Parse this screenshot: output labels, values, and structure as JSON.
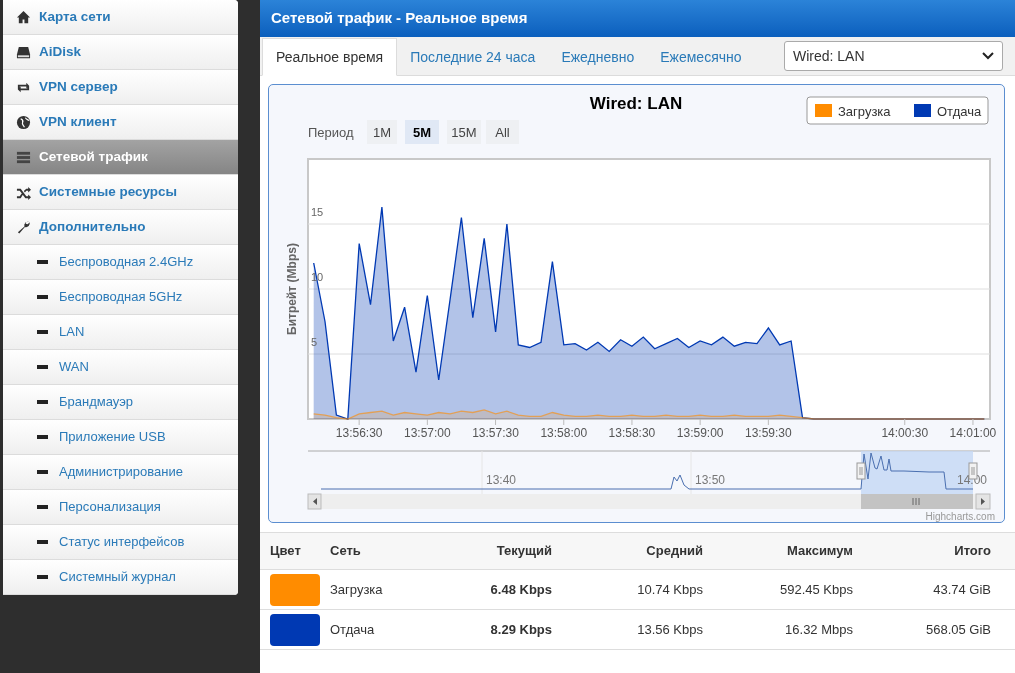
{
  "sidebar": {
    "items": [
      {
        "label": "Карта сети",
        "kind": "section",
        "selected": false
      },
      {
        "label": "AiDisk",
        "kind": "section",
        "selected": false
      },
      {
        "label": "VPN сервер",
        "kind": "section",
        "selected": false
      },
      {
        "label": "VPN клиент",
        "kind": "section",
        "selected": false
      },
      {
        "label": "Сетевой трафик",
        "kind": "section",
        "selected": true
      },
      {
        "label": "Системные ресурсы",
        "kind": "section",
        "selected": false
      },
      {
        "label": "Дополнительно",
        "kind": "section",
        "selected": false
      },
      {
        "label": "Беспроводная 2.4GHz",
        "kind": "sub",
        "selected": false
      },
      {
        "label": "Беспроводная 5GHz",
        "kind": "sub",
        "selected": false
      },
      {
        "label": "LAN",
        "kind": "sub",
        "selected": false
      },
      {
        "label": "WAN",
        "kind": "sub",
        "selected": false
      },
      {
        "label": "Брандмауэр",
        "kind": "sub",
        "selected": false
      },
      {
        "label": "Приложение USB",
        "kind": "sub",
        "selected": false
      },
      {
        "label": "Администрирование",
        "kind": "sub",
        "selected": false
      },
      {
        "label": "Персонализация",
        "kind": "sub",
        "selected": false
      },
      {
        "label": "Статус интерфейсов",
        "kind": "sub",
        "selected": false
      },
      {
        "label": "Системный журнал",
        "kind": "sub",
        "selected": false
      }
    ]
  },
  "panel": {
    "title": "Сетевой трафик - Реальное время",
    "tabs": [
      {
        "label": "Реальное время",
        "selected": true
      },
      {
        "label": "Последние 24 часа",
        "selected": false
      },
      {
        "label": "Ежедневно",
        "selected": false
      },
      {
        "label": "Ежемесячно",
        "selected": false
      }
    ],
    "interface_select": {
      "value": "Wired: LAN"
    },
    "chart": {
      "period_label": "Период",
      "range_buttons": [
        {
          "label": "1M",
          "selected": false
        },
        {
          "label": "5M",
          "selected": true
        },
        {
          "label": "15M",
          "selected": false
        },
        {
          "label": "All",
          "selected": false
        }
      ],
      "navigator_labels": [
        "13:40",
        "13:50",
        "14:00"
      ],
      "credit": "Highcharts.com",
      "chart_data": {
        "type": "area",
        "title": "Wired: LAN",
        "ylabel": "Битрейт (Mbps)",
        "categories": [
          null,
          null,
          null,
          null,
          "13:56:30",
          null,
          null,
          null,
          null,
          null,
          "13:57:00",
          null,
          null,
          null,
          null,
          null,
          "13:57:30",
          null,
          null,
          null,
          null,
          null,
          "13:58:00",
          null,
          null,
          null,
          null,
          null,
          "13:58:30",
          null,
          null,
          null,
          null,
          null,
          "13:59:00",
          null,
          null,
          null,
          null,
          null,
          "13:59:30",
          null,
          null,
          null,
          null,
          null,
          null,
          null,
          null,
          null,
          null,
          null,
          "14:00:30",
          null,
          null,
          null,
          null,
          null,
          "14:01:00",
          null
        ],
        "series": [
          {
            "name": "Загрузка",
            "color": "#ff8c00",
            "values": [
              0.4,
              0.3,
              0.1,
              0,
              0.4,
              0.5,
              0.6,
              0.3,
              0.5,
              0.4,
              0.3,
              0.5,
              0.4,
              0.6,
              0.5,
              0.7,
              0.4,
              0.6,
              0.3,
              0.2,
              0.2,
              0.5,
              0.3,
              0.2,
              0.2,
              0.3,
              0.2,
              0.2,
              0.3,
              0.2,
              0.2,
              0.3,
              0.2,
              0.2,
              0.3,
              0.2,
              0.2,
              0.3,
              0.2,
              0.2,
              0.2,
              0.3,
              0.2,
              0.1,
              0,
              0,
              0,
              0,
              0,
              0,
              0,
              0,
              0,
              0,
              0,
              0,
              0,
              0,
              0,
              0
            ]
          },
          {
            "name": "Отдача",
            "color": "#0039b3",
            "values": [
              12.0,
              7.5,
              0.3,
              0,
              13.5,
              8.8,
              16.3,
              6.0,
              8.6,
              3.6,
              9.5,
              3.0,
              9.2,
              15.5,
              7.8,
              13.9,
              6.7,
              15.0,
              5.7,
              5.5,
              5.9,
              12.1,
              5.7,
              5.8,
              5.3,
              5.9,
              5.2,
              6.1,
              5.6,
              6.3,
              5.4,
              5.8,
              6.2,
              5.5,
              6.0,
              5.7,
              6.3,
              5.6,
              5.9,
              5.8,
              7.0,
              5.7,
              6.0,
              0.1,
              0,
              0,
              0,
              0,
              0,
              0,
              0,
              0,
              0,
              0,
              0,
              0,
              0,
              0,
              0,
              0
            ]
          }
        ],
        "ylim": [
          0,
          20
        ],
        "yticks": [
          5,
          10,
          15
        ],
        "grid": true,
        "legend": true
      }
    },
    "table": {
      "columns": [
        "Цвет",
        "Сеть",
        "Текущий",
        "Средний",
        "Максимум",
        "Итого"
      ],
      "rows": [
        {
          "color": "#ff8c00",
          "network": "Загрузка",
          "current": "6.48 Kbps",
          "average": "10.74 Kbps",
          "max": "592.45 Kbps",
          "total": "43.74 GiB"
        },
        {
          "color": "#0039b3",
          "network": "Отдача",
          "current": "8.29 Kbps",
          "average": "13.56 Kbps",
          "max": "16.32 Mbps",
          "total": "568.05 GiB"
        }
      ]
    }
  }
}
